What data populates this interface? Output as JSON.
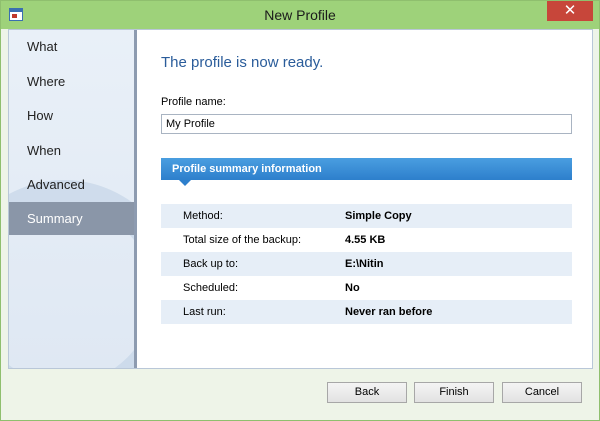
{
  "window": {
    "title": "New Profile",
    "close_label": "✕"
  },
  "sidebar": {
    "items": [
      {
        "label": "What"
      },
      {
        "label": "Where"
      },
      {
        "label": "How"
      },
      {
        "label": "When"
      },
      {
        "label": "Advanced"
      },
      {
        "label": "Summary",
        "selected": true
      }
    ]
  },
  "main": {
    "heading": "The profile is now ready.",
    "profile_name_label": "Profile name:",
    "profile_name_value": "My Profile",
    "summary_title": "Profile summary information",
    "summary": [
      {
        "label": "Method:",
        "value": "Simple Copy"
      },
      {
        "label": "Total size of the backup:",
        "value": "4.55 KB"
      },
      {
        "label": "Back up to:",
        "value": "E:\\Nitin"
      },
      {
        "label": "Scheduled:",
        "value": "No"
      },
      {
        "label": "Last run:",
        "value": "Never ran before"
      }
    ]
  },
  "footer": {
    "back_label": "Back",
    "finish_label": "Finish",
    "cancel_label": "Cancel"
  },
  "colors": {
    "accent": "#2d7fcc",
    "titlebar": "#9ed27a",
    "close": "#c7463a",
    "selected": "#8a96a8"
  }
}
